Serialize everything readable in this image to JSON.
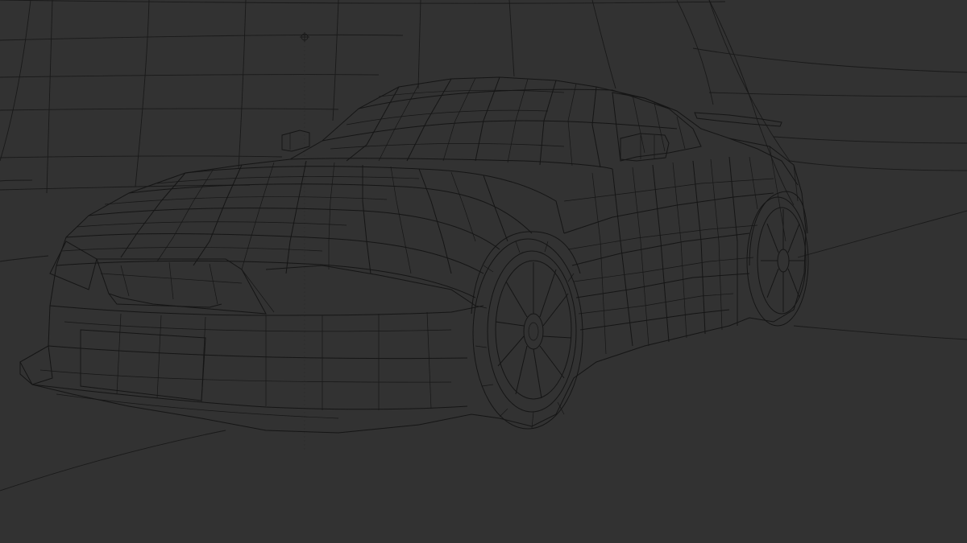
{
  "viewport": {
    "mode": "wireframe",
    "background_color": "#323232",
    "wire_color": "#151515"
  },
  "scene": {
    "objects": [
      "car-body",
      "front-wheel",
      "rear-wheel",
      "side-mirror-left",
      "side-mirror-right",
      "rear-spoiler",
      "environment-backdrop",
      "empty-object-origin"
    ]
  }
}
